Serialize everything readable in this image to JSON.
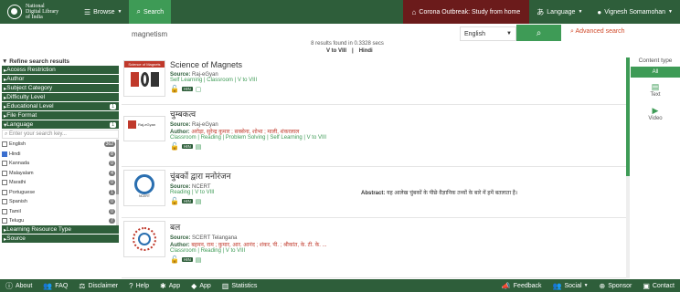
{
  "header": {
    "logo_text_line1": "National",
    "logo_text_line2": "Digital Library",
    "logo_text_line3": "of India",
    "browse": "Browse",
    "search_tab": "Search",
    "corona": "Corona Outbreak: Study from home",
    "language": "Language",
    "user": "Vignesh Somamohan"
  },
  "search": {
    "query": "magnetism",
    "language": "English",
    "advanced": "Advanced search",
    "results_count": "8 results found in 0.3328 secs",
    "chip1": "V to VIII",
    "chip2": "Hindi"
  },
  "sidebar": {
    "refine": "Refine search results",
    "facets_top": [
      {
        "label": "Access Restriction",
        "badge": ""
      },
      {
        "label": "Author",
        "badge": ""
      },
      {
        "label": "Subject Category",
        "badge": ""
      },
      {
        "label": "Difficulty Level",
        "badge": ""
      },
      {
        "label": "Educational Level",
        "badge": "1"
      },
      {
        "label": "File Format",
        "badge": ""
      },
      {
        "label": "Language",
        "badge": "1"
      }
    ],
    "lang_search_placeholder": "Enter your search key...",
    "languages": [
      {
        "name": "English",
        "count": "362",
        "checked": false
      },
      {
        "name": "Hindi",
        "count": "8",
        "checked": true
      },
      {
        "name": "Kannada",
        "count": "0",
        "checked": false
      },
      {
        "name": "Malayalam",
        "count": "4",
        "checked": false
      },
      {
        "name": "Marathi",
        "count": "0",
        "checked": false
      },
      {
        "name": "Portuguese",
        "count": "1",
        "checked": false
      },
      {
        "name": "Spanish",
        "count": "0",
        "checked": false
      },
      {
        "name": "Tamil",
        "count": "0",
        "checked": false
      },
      {
        "name": "Telugu",
        "count": "7",
        "checked": false
      }
    ],
    "facets_bottom": [
      {
        "label": "Learning Resource Type"
      },
      {
        "label": "Source"
      }
    ]
  },
  "results": [
    {
      "title": "Science of Magnets",
      "source_label": "Source:",
      "source": "Raj-eGyan",
      "author": "",
      "tags": "Self Learning  |  Classroom  |  V to VIII",
      "hin": "HIN"
    },
    {
      "title": "चुम्बकत्व",
      "source_label": "Source:",
      "source": "Raj-eGyan",
      "author_label": "Author:",
      "author": "अरोड़ा, सुरेन्द्र कुमार ; सक्सेना, शोभा ; माली, शंकरलाल",
      "tags": "Classroom  |  Reading  |  Problem Solving  |  Self Learning  |  V to VIII",
      "hin": "HIN"
    },
    {
      "title": "चुंबकों द्वारा मनोरंजन",
      "source_label": "Source:",
      "source": "NCERT",
      "author": "",
      "tags": "Reading  |  V to VIII",
      "hin": "HIN",
      "abstract_label": "Abstract:",
      "abstract": "यह आलेख चुंबकों के पीछे वैज्ञानिक तथ्यों के बारे में हमें बतलाता है।"
    },
    {
      "title": "बल",
      "source_label": "Source:",
      "source": "SCERT Telangana",
      "author_label": "Author:",
      "author": "बहमन, राम ; कुमार, आर. आनंद ; शंकर, पी. ; श्रीकांत, के. टी. के. ...",
      "tags": "Classroom  |  Reading  |  V to VIII",
      "hin": "HIN"
    }
  ],
  "content_type": {
    "title": "Content type",
    "all": "All",
    "text": "Text",
    "video": "Video"
  },
  "footer": {
    "about": "About",
    "faq": "FAQ",
    "disclaimer": "Disclaimer",
    "help": "Help",
    "app1": "App",
    "app2": "App",
    "statistics": "Statistics",
    "feedback": "Feedback",
    "social": "Social",
    "sponsor": "Sponsor",
    "contact": "Contact"
  }
}
